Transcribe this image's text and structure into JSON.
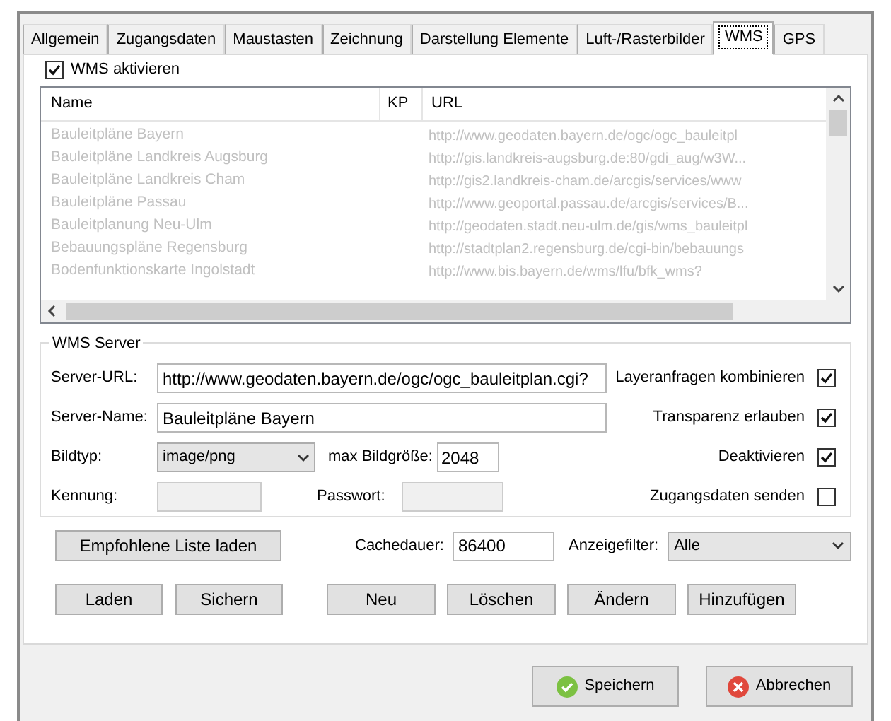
{
  "tabs": [
    {
      "label": "Allgemein",
      "selected": false
    },
    {
      "label": "Zugangsdaten",
      "selected": false
    },
    {
      "label": "Maustasten",
      "selected": false
    },
    {
      "label": "Zeichnung",
      "selected": false
    },
    {
      "label": "Darstellung Elemente",
      "selected": false
    },
    {
      "label": "Luft-/Rasterbilder",
      "selected": false
    },
    {
      "label": "WMS",
      "selected": true
    },
    {
      "label": "GPS",
      "selected": false
    }
  ],
  "wms_enabled": {
    "label": "WMS aktivieren",
    "checked": true
  },
  "layer_list": {
    "disabled": true,
    "columns": [
      "Name",
      "KP",
      "URL"
    ],
    "rows": [
      {
        "name": "Bauleitpläne Bayern",
        "url": "http://www.geodaten.bayern.de/ogc/ogc_bauleitpl"
      },
      {
        "name": "Bauleitpläne Landkreis Augsburg",
        "url": "http://gis.landkreis-augsburg.de:80/gdi_aug/w3W..."
      },
      {
        "name": "Bauleitpläne Landkreis Cham",
        "url": "http://gis2.landkreis-cham.de/arcgis/services/www"
      },
      {
        "name": "Bauleitpläne Passau",
        "url": "http://www.geoportal.passau.de/arcgis/services/B..."
      },
      {
        "name": "Bauleitplanung Neu-Ulm",
        "url": "http://geodaten.stadt.neu-ulm.de/gis/wms_bauleitpl"
      },
      {
        "name": "Bebauungspläne Regensburg",
        "url": "http://stadtplan2.regensburg.de/cgi-bin/bebauungs"
      },
      {
        "name": "Bodenfunktionskarte Ingolstadt",
        "url": "http://www.bis.bayern.de/wms/lfu/bfk_wms?"
      }
    ]
  },
  "wms_server": {
    "title": "WMS Server",
    "server_url": {
      "label": "Server-URL:",
      "value": "http://www.geodaten.bayern.de/ogc/ogc_bauleitplan.cgi?"
    },
    "server_name": {
      "label": "Server-Name:",
      "value": "Bauleitpläne Bayern"
    },
    "image_type": {
      "label": "Bildtyp:",
      "value": "image/png"
    },
    "max_image_size": {
      "label": "max Bildgröße:",
      "value": "2048"
    },
    "login": {
      "label": "Kennung:"
    },
    "password": {
      "label": "Passwort:"
    },
    "options": [
      {
        "label": "Layeranfragen kombinieren",
        "checked": true
      },
      {
        "label": "Transparenz erlauben",
        "checked": true
      },
      {
        "label": "Deaktivieren",
        "checked": true
      },
      {
        "label": "Zugangsdaten senden",
        "checked": false
      }
    ]
  },
  "load_recommended_button": "Empfohlene Liste laden",
  "cache_duration": {
    "label": "Cachedauer:",
    "value": "86400"
  },
  "display_filter": {
    "label": "Anzeigefilter:",
    "value": "Alle"
  },
  "list_buttons": [
    "Laden",
    "Sichern"
  ],
  "entry_buttons": [
    "Neu",
    "Löschen",
    "Ändern",
    "Hinzufügen"
  ],
  "save_button": "Speichern",
  "cancel_button": "Abbrechen"
}
